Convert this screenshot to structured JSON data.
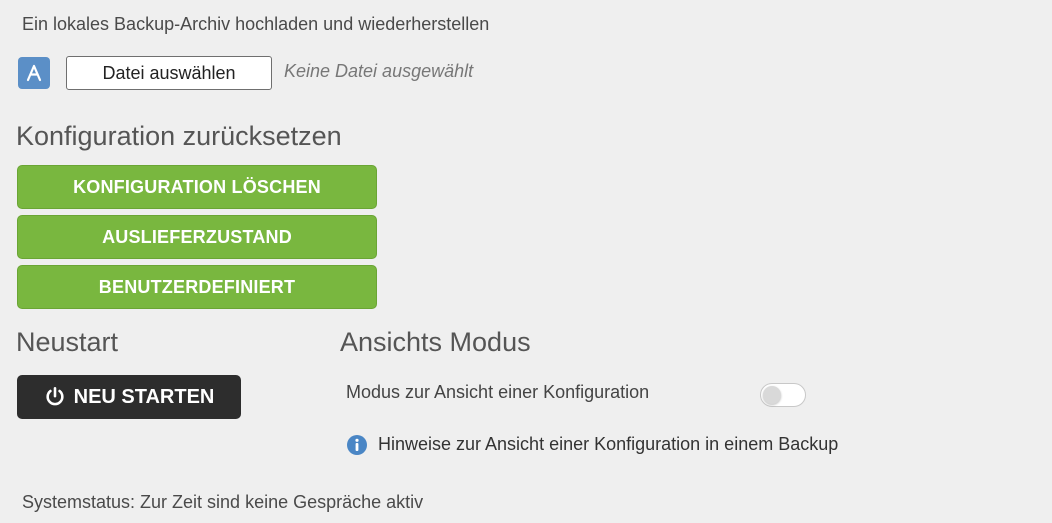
{
  "upload": {
    "label": "Ein lokales Backup-Archiv hochladen und wiederherstellen",
    "file_button_label": "Datei auswählen",
    "file_status": "Keine Datei ausgewählt",
    "badge_icon": "upload-arrow-icon",
    "badge_color": "#5b8fc7"
  },
  "reset": {
    "heading": "Konfiguration zurücksetzen",
    "delete_label": "KONFIGURATION LÖSCHEN",
    "factory_label": "AUSLIEFERZUSTAND",
    "custom_label": "BENUTZERDEFINIERT",
    "button_color": "#79b73f"
  },
  "restart": {
    "heading": "Neustart",
    "button_label": "NEU STARTEN",
    "button_icon": "power-icon",
    "button_color": "#2d2d2d"
  },
  "view_mode": {
    "heading": "Ansichts Modus",
    "toggle_label": "Modus zur Ansicht einer Konfiguration",
    "toggle_on": false,
    "info_icon": "info-icon",
    "info_text": "Hinweise zur Ansicht einer Konfiguration in einem Backup",
    "info_icon_color": "#4a86c5"
  },
  "status": {
    "text": "Systemstatus: Zur Zeit sind keine Gespräche aktiv"
  }
}
